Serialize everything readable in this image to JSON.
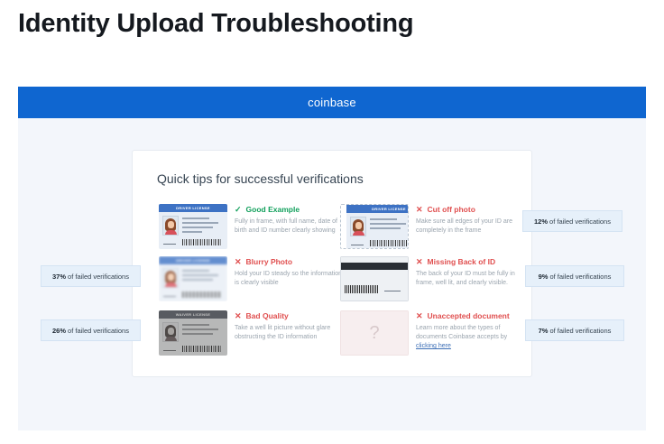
{
  "page": {
    "title": "Identity Upload Troubleshooting"
  },
  "banner": {
    "brand": "coinbase"
  },
  "card": {
    "title": "Quick tips for successful verifications",
    "id_label": "DRIVER LICENSE",
    "id_label_gray": "WAIVER LICENSE",
    "tips": [
      {
        "status": "✓",
        "heading": "Good Example",
        "desc": "Fully in frame, with full name, date of birth and ID number clearly showing"
      },
      {
        "status": "✕",
        "heading": "Cut off photo",
        "desc": "Make sure all edges of your ID are completely in the frame"
      },
      {
        "status": "✕",
        "heading": "Blurry Photo",
        "desc": "Hold your ID steady so the information is clearly visible"
      },
      {
        "status": "✕",
        "heading": "Missing Back of ID",
        "desc": "The back of your ID must be fully in frame, well lit, and clearly visible."
      },
      {
        "status": "✕",
        "heading": "Bad Quality",
        "desc": "Take a well lit picture without glare obstructing the ID information"
      },
      {
        "status": "✕",
        "heading": "Unaccepted document",
        "desc": "Learn more about the types of documents Coinbase accepts by",
        "link": "clicking here",
        "placeholder": "?"
      }
    ]
  },
  "stats": [
    {
      "pct": "12%",
      "label": "of failed verifications"
    },
    {
      "pct": "37%",
      "label": "of failed verifications"
    },
    {
      "pct": "9%",
      "label": "of failed verifications"
    },
    {
      "pct": "26%",
      "label": "of failed verifications"
    },
    {
      "pct": "7%",
      "label": "of failed verifications"
    }
  ],
  "colors": {
    "banner": "#0f66d0",
    "good": "#12a05c",
    "bad": "#e04f4f",
    "stat_bg": "#e6f0fa"
  }
}
